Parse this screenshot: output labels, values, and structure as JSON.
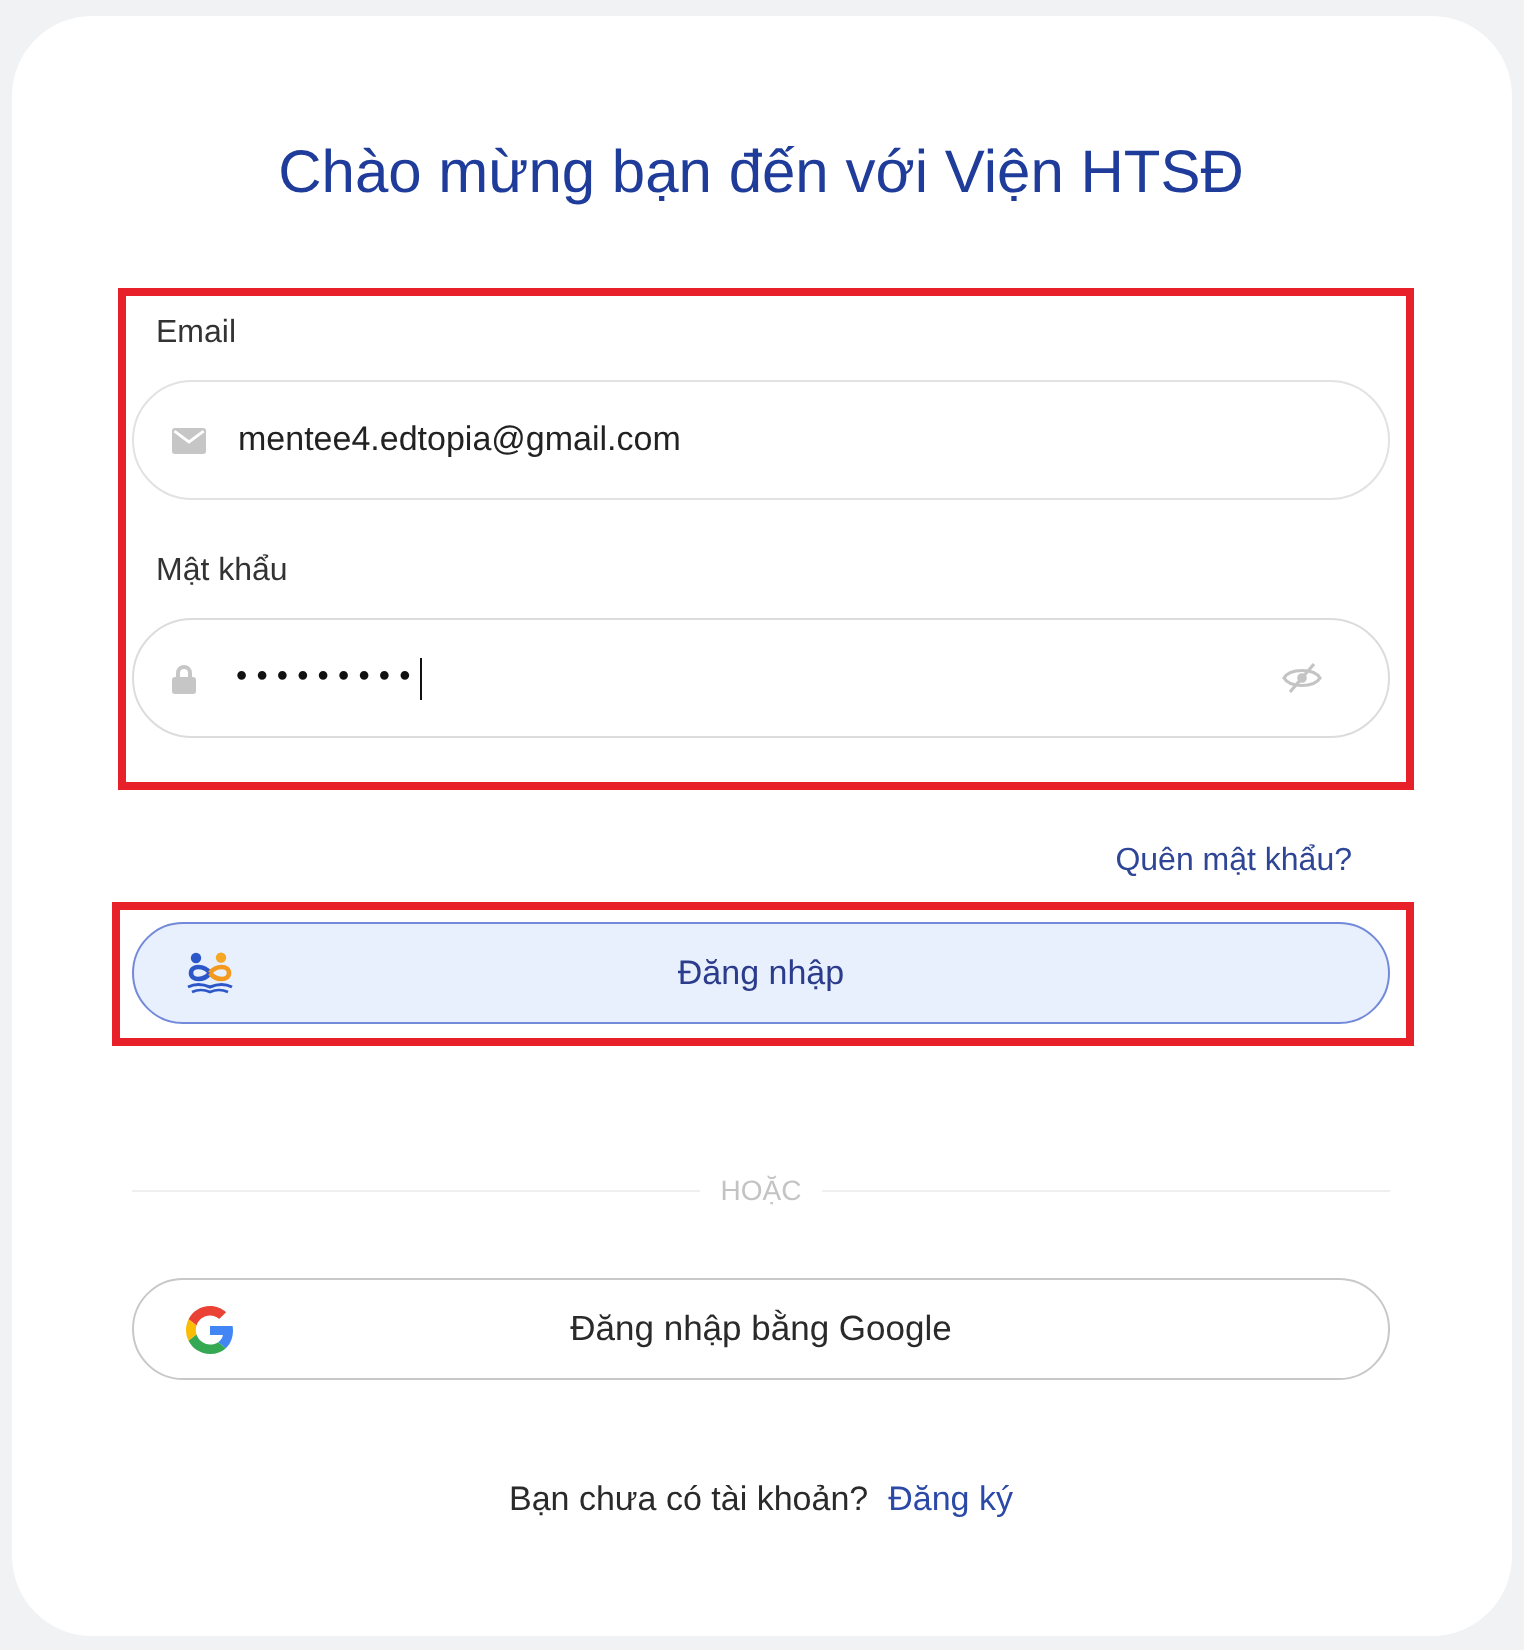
{
  "card": {
    "title": "Chào mừng bạn đến với Viện HTSĐ"
  },
  "credentials": {
    "highlighted": true,
    "fields": [
      {
        "kind": "email",
        "label": "Email",
        "value": "mentee4.edtopia@gmail.com",
        "focused": false
      },
      {
        "kind": "password",
        "label": "Mật khẩu",
        "value": "•••••••••",
        "focused": true,
        "show_password": false
      }
    ]
  },
  "forgot_link": "Quên mật khẩu?",
  "login_button": {
    "label": "Đăng nhập",
    "highlighted": true
  },
  "divider": {
    "label": "HOẶC"
  },
  "google_button": {
    "label": "Đăng nhập bằng Google"
  },
  "footer": {
    "text": "Bạn chưa có tài khoản?",
    "link": "Đăng ký"
  }
}
